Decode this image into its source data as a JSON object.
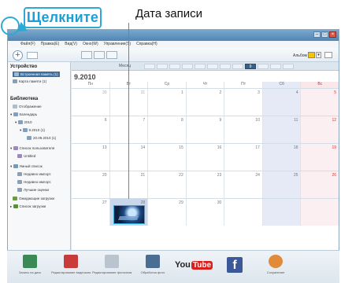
{
  "callouts": {
    "click_label": "Щелкните",
    "date_label": "Дата записи"
  },
  "window": {
    "menu": [
      "Файл(F)",
      "Правка(E)",
      "Вид(V)",
      "Окно(W)",
      "Управление(S)",
      "Справка(H)"
    ],
    "toolbar": {
      "add_symbol": "+",
      "album_label": "Альбом"
    }
  },
  "sidebar": {
    "device_heading": "Устройство",
    "device_items": [
      "Встроенная память (1)",
      "Карта памяти (1)"
    ],
    "library_heading": "Библиотека",
    "library_items": [
      "Отображение",
      "Календарь",
      "2010",
      "9.2010 (1)",
      "20.09.2010 (1)",
      "Список пользователя",
      "Untitled",
      "Умный список",
      "Недавно импорт.",
      "Недавно импорт.",
      "Лучшие оценки",
      "Ожидающие загрузки",
      "Список загрузки"
    ]
  },
  "calendar": {
    "month_word": "Месяц",
    "current_month": "9",
    "year_month": "9.2010",
    "weekdays": [
      "Пн",
      "Вт",
      "Ср",
      "Чт",
      "Пт",
      "Сб",
      "Вс"
    ],
    "weeks": [
      [
        "30",
        "31",
        "1",
        "2",
        "3",
        "4",
        "5"
      ],
      [
        "6",
        "7",
        "8",
        "9",
        "10",
        "11",
        "12"
      ],
      [
        "13",
        "14",
        "15",
        "16",
        "17",
        "18",
        "19"
      ],
      [
        "20",
        "21",
        "22",
        "23",
        "24",
        "25",
        "26"
      ],
      [
        "27",
        "28",
        "29",
        "30",
        "",
        "",
        ""
      ]
    ]
  },
  "actions": [
    {
      "label": "Запись на диск",
      "icon": "disc-burn-icon",
      "color": "#3b8a55"
    },
    {
      "label": "Редактирование видеозаписей",
      "icon": "video-edit-icon",
      "color": "#c93a3a"
    },
    {
      "label": "Редактирование фотоснимков",
      "icon": "photo-edit-icon",
      "color": "#b9c4cf"
    },
    {
      "label": "Обработка фото",
      "icon": "export-icon",
      "color": "#4b6d92"
    },
    {
      "label": "YouTube",
      "icon": "youtube-icon",
      "color": "#d6201e"
    },
    {
      "label": "Facebook",
      "icon": "facebook-icon",
      "color": "#3b5998"
    },
    {
      "label": "Сохранение",
      "icon": "save-icon",
      "color": "#e08a3a"
    }
  ],
  "youtube": {
    "you": "You",
    "tube": "Tube"
  },
  "facebook": {
    "glyph": "f"
  }
}
